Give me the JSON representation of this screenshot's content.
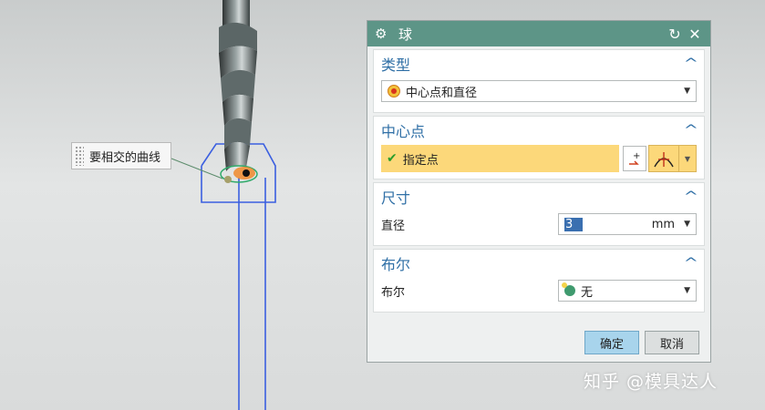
{
  "viewport": {
    "tooltip": "要相交的曲线"
  },
  "dialog": {
    "title": "球",
    "title_icon": "gear-icon",
    "reset_icon": "reset-icon",
    "close_icon": "close-icon",
    "sections": {
      "type": {
        "header": "类型",
        "value": "中心点和直径"
      },
      "center": {
        "header": "中心点",
        "point_label": "指定点"
      },
      "size": {
        "header": "尺寸",
        "diameter_label": "直径",
        "diameter_value": "3",
        "unit": "mm"
      },
      "boolean": {
        "header": "布尔",
        "boolean_label": "布尔",
        "boolean_value": "无"
      }
    },
    "buttons": {
      "ok": "确定",
      "cancel": "取消"
    }
  },
  "watermark": "知乎 @模具达人",
  "colors": {
    "titlebar": "#5d9587",
    "section_header": "#2f6fa6",
    "selected_field": "#fcd87a",
    "curve": "#3b5fe0"
  }
}
